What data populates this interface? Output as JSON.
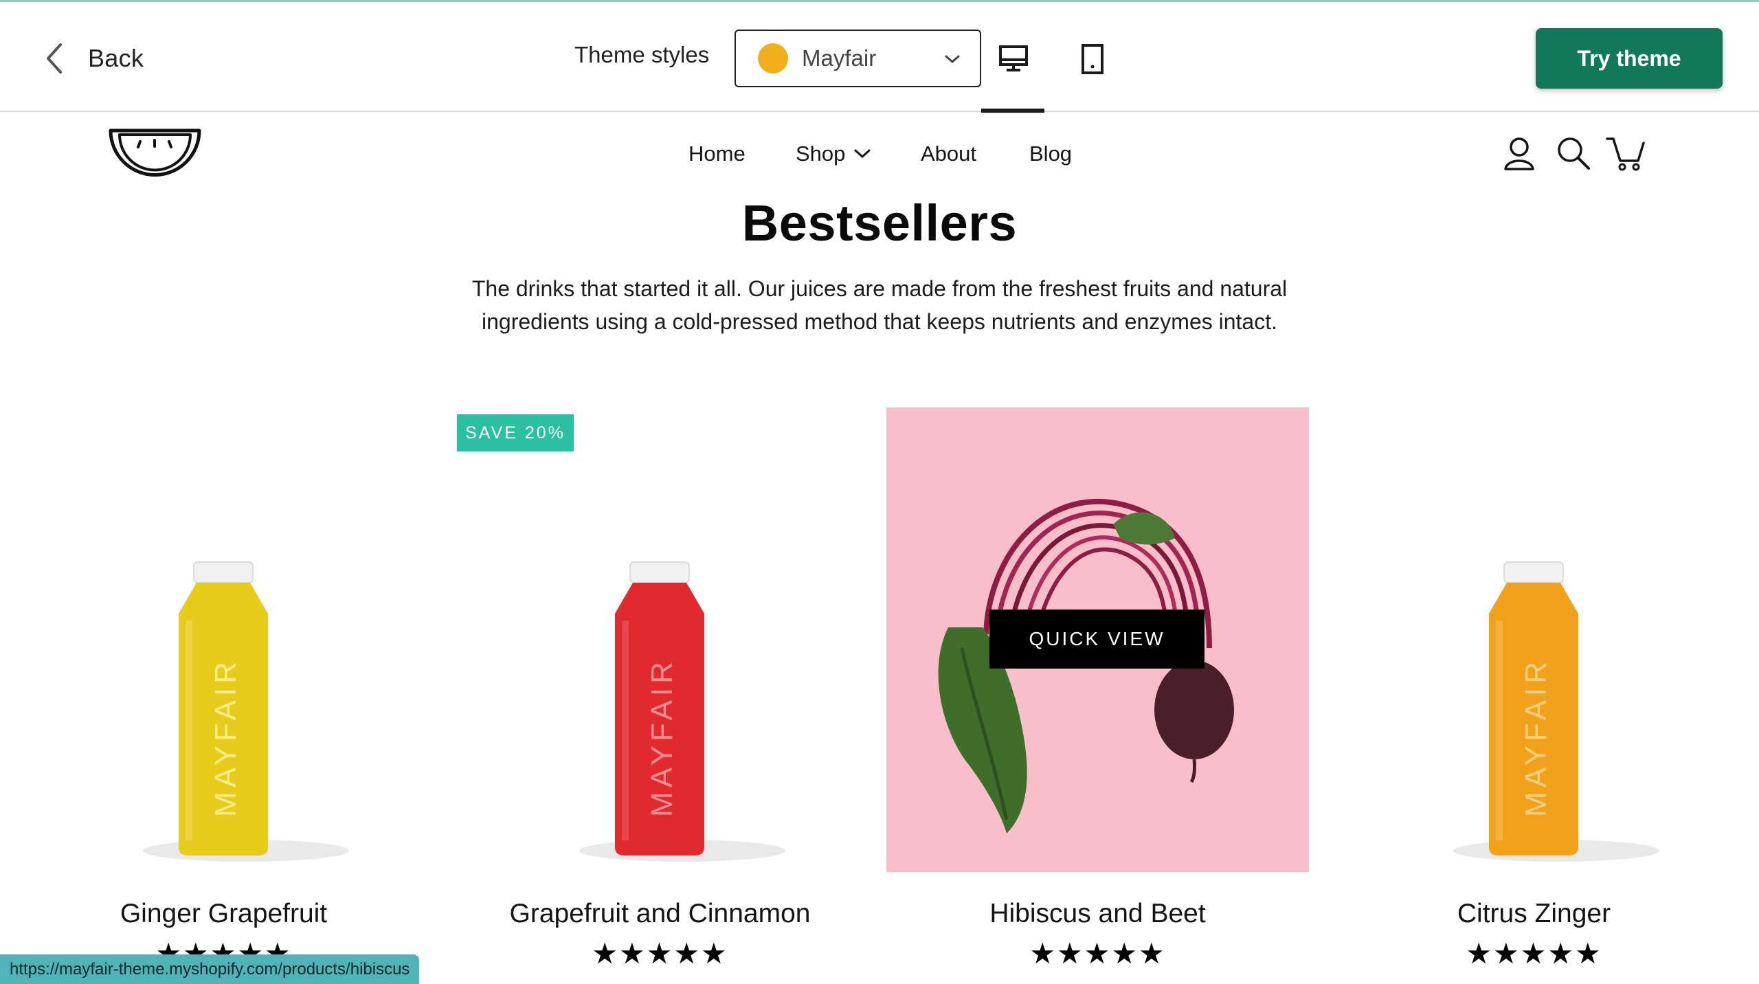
{
  "topbar": {
    "back_label": "Back",
    "theme_styles_label": "Theme styles",
    "theme_select_value": "Mayfair",
    "theme_swatch_color": "#f2b01c",
    "try_theme_label": "Try theme",
    "try_theme_color": "#12785a",
    "active_device": "desktop"
  },
  "nav": {
    "items": [
      {
        "label": "Home"
      },
      {
        "label": "Shop"
      },
      {
        "label": "About"
      },
      {
        "label": "Blog"
      }
    ]
  },
  "section": {
    "title": "Bestsellers",
    "description": "The drinks that started it all. Our juices are made from the freshest fruits and natural ingredients using a cold-pressed method that keeps nutrients and enzymes intact."
  },
  "products": [
    {
      "name": "Ginger Grapefruit",
      "rating": "★★★★★",
      "bottle_color": "#e8cc1c",
      "bottle_label": "MAYFAIR"
    },
    {
      "name": "Grapefruit and Cinnamon",
      "rating": "★★★★★",
      "bottle_color": "#e12a2f",
      "bottle_label": "MAYFAIR",
      "badge": "SAVE 20%"
    },
    {
      "name": "Hibiscus and Beet",
      "rating": "★★★★★",
      "quick_view_label": "QUICK VIEW",
      "image_bg": "#f8bfcb"
    },
    {
      "name": "Citrus Zinger",
      "rating": "★★★★★",
      "bottle_color": "#f2a21a",
      "bottle_label": "MAYFAIR"
    }
  ],
  "status_bar": {
    "url": "https://mayfair-theme.myshopify.com/products/hibiscus"
  },
  "icons": [
    "chevron-left-icon",
    "chevron-down-icon",
    "desktop-icon",
    "mobile-icon",
    "watermelon-logo",
    "account-icon",
    "search-icon",
    "cart-icon"
  ]
}
